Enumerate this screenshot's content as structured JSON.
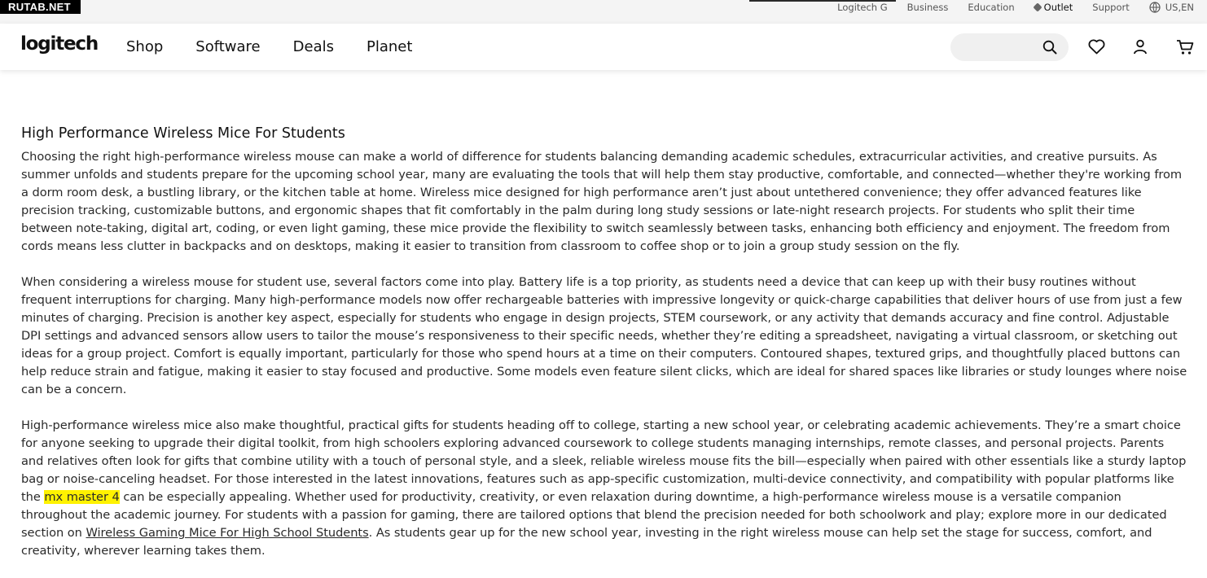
{
  "watermark": "RUTAB.NET",
  "utility": {
    "links": [
      "Logitech G",
      "Business",
      "Education"
    ],
    "outlet": "Outlet",
    "support": "Support",
    "locale": "US,EN"
  },
  "nav": {
    "logo": "logitech",
    "items": [
      "Shop",
      "Software",
      "Deals",
      "Planet"
    ],
    "search_placeholder": ""
  },
  "article": {
    "heading": "High Performance Wireless Mice For Students",
    "p1": "Choosing the right high-performance wireless mouse can make a world of difference for students balancing demanding academic schedules, extracurricular activities, and creative pursuits. As summer unfolds and students prepare for the upcoming school year, many are evaluating the tools that will help them stay productive, comfortable, and connected—whether they're working from a dorm room desk, a bustling library, or the kitchen table at home. Wireless mice designed for high performance aren’t just about untethered convenience; they offer advanced features like precision tracking, customizable buttons, and ergonomic shapes that fit comfortably in the palm during long study sessions or late-night research projects. For students who split their time between note-taking, digital art, coding, or even light gaming, these mice provide the flexibility to switch seamlessly between tasks, enhancing both efficiency and enjoyment. The freedom from cords means less clutter in backpacks and on desktops, making it easier to transition from classroom to coffee shop or to join a group study session on the fly.",
    "p2": "When considering a wireless mouse for student use, several factors come into play. Battery life is a top priority, as students need a device that can keep up with their busy routines without frequent interruptions for charging. Many high-performance models now offer rechargeable batteries with impressive longevity or quick-charge capabilities that deliver hours of use from just a few minutes of charging. Precision is another key aspect, especially for students who engage in design projects, STEM coursework, or any activity that demands accuracy and fine control. Adjustable DPI settings and advanced sensors allow users to tailor the mouse’s responsiveness to their specific needs, whether they’re editing a spreadsheet, navigating a virtual classroom, or sketching out ideas for a group project. Comfort is equally important, particularly for those who spend hours at a time on their computers. Contoured shapes, textured grips, and thoughtfully placed buttons can help reduce strain and fatigue, making it easier to stay focused and productive. Some models even feature silent clicks, which are ideal for shared spaces like libraries or study lounges where noise can be a concern.",
    "p3_a": "High-performance wireless mice also make thoughtful, practical gifts for students heading off to college, starting a new school year, or celebrating academic achievements. They’re a smart choice for anyone seeking to upgrade their digital toolkit, from high schoolers exploring advanced coursework to college students managing internships, remote classes, and personal projects. Parents and relatives often look for gifts that combine utility with a touch of personal style, and a sleek, reliable wireless mouse fits the bill—especially when paired with other essentials like a sturdy laptop bag or noise-canceling headset. For those interested in the latest innovations, features such as app-specific customization, multi-device connectivity, and compatibility with popular platforms like the ",
    "p3_highlight": "mx master 4",
    "p3_b": " can be especially appealing. Whether used for productivity, creativity, or even relaxation during downtime, a high-performance wireless mouse is a versatile companion throughout the academic journey. For students with a passion for gaming, there are tailored options that blend the precision needed for both schoolwork and play; explore more in our dedicated section on ",
    "p3_link": "Wireless Gaming Mice For High School Students",
    "p3_c": ". As students gear up for the new school year, investing in the right wireless mouse can help set the stage for success, comfort, and creativity, wherever learning takes them."
  },
  "colors": {
    "highlight": "#fff200",
    "utility_bg": "#f4f4f4",
    "search_bg": "#f0f0f0"
  },
  "icons": [
    "tag-icon",
    "globe-icon",
    "search-icon",
    "heart-icon",
    "user-icon",
    "cart-icon"
  ]
}
